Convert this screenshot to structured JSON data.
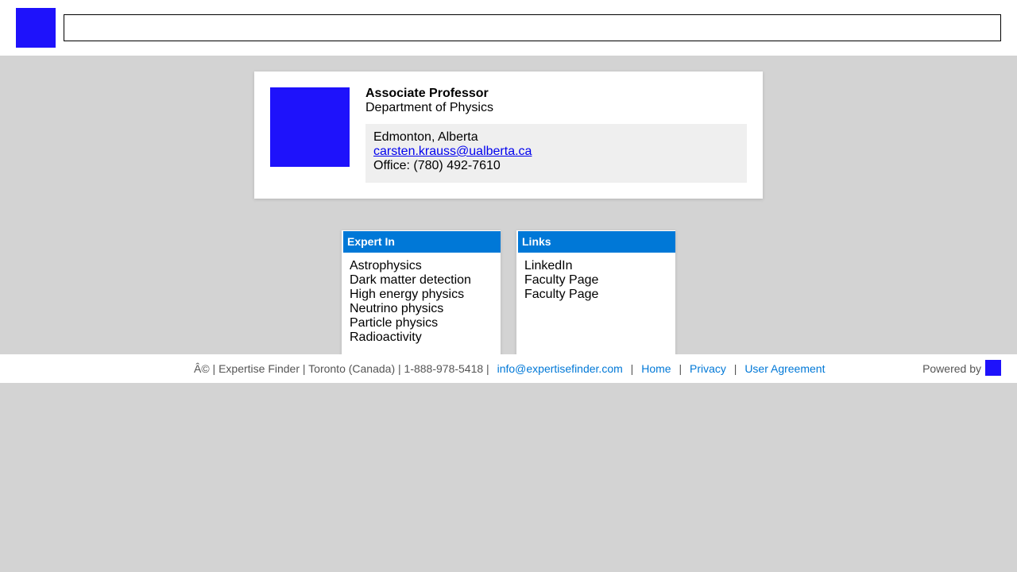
{
  "header": {
    "search_value": "",
    "search_placeholder": "",
    "logo_color": "#1e12fb"
  },
  "profile": {
    "title": "Associate Professor",
    "department": "Department of Physics",
    "location": "Edmonton, Alberta",
    "email": "carsten.krauss@ualberta.ca",
    "phone": "Office: (780) 492-7610",
    "photo_color": "#1e12fb"
  },
  "expert": {
    "header": "Expert In",
    "items": [
      "Astrophysics",
      "Dark matter detection",
      "High energy physics",
      "Neutrino physics",
      "Particle physics",
      "Radioactivity"
    ]
  },
  "links": {
    "header": "Links",
    "items": [
      "LinkedIn",
      "Faculty Page",
      "Faculty Page"
    ]
  },
  "footer": {
    "info": "Â© | Expertise Finder | Toronto (Canada) | 1-888-978-5418 |",
    "email": "info@expertisefinder.com",
    "home": "Home",
    "privacy": "Privacy",
    "agreement": "User Agreement",
    "separator": "|",
    "powered_by": "Powered by"
  },
  "colors": {
    "accent": "#0078d7",
    "brand": "#1e12fb",
    "background": "#d3d3d3"
  }
}
